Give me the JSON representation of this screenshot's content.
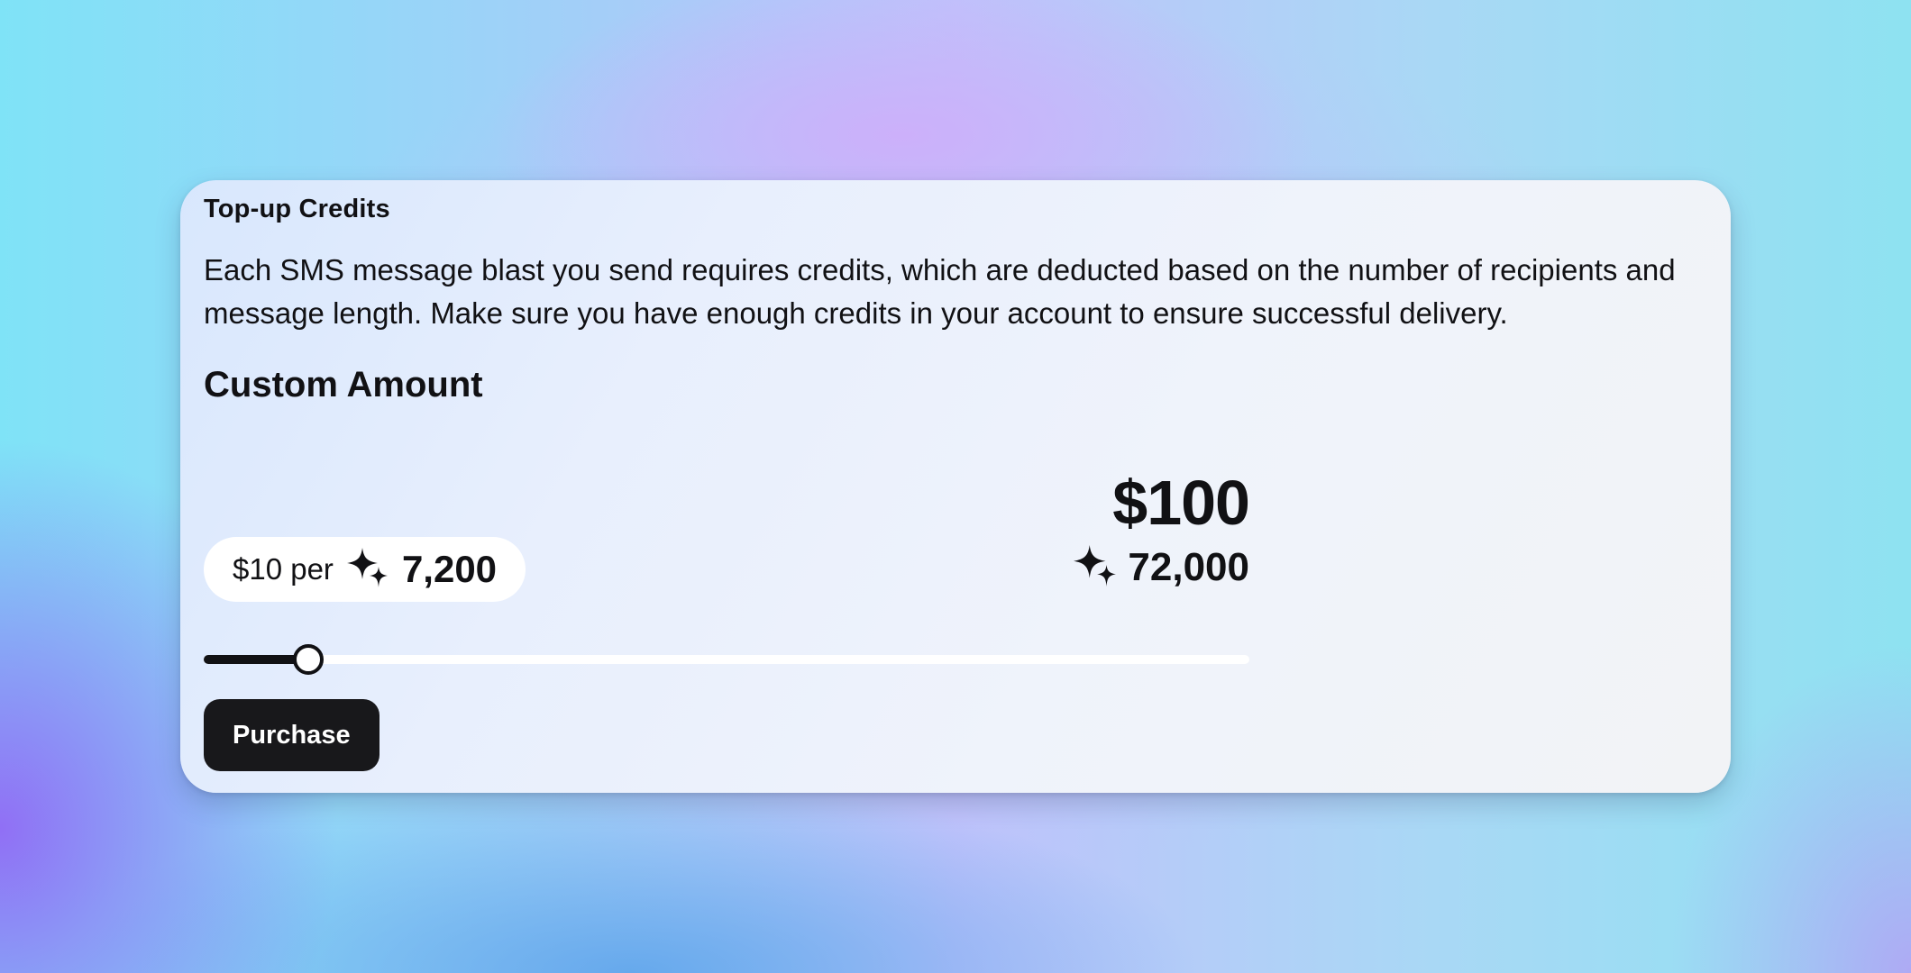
{
  "card": {
    "title": "Top-up Credits",
    "description": "Each SMS message blast you send requires credits, which are deducted based on the number of recipients and message length. Make sure you have enough credits in your account to ensure successful delivery.",
    "section_title": "Custom Amount"
  },
  "rate": {
    "prefix": "$10 per",
    "icon": "sparkles-icon",
    "credits": "7,200"
  },
  "total": {
    "amount": "$100",
    "icon": "sparkles-icon",
    "credits": "72,000"
  },
  "slider": {
    "level": 0.1
  },
  "actions": {
    "purchase_label": "Purchase"
  },
  "colors": {
    "primary": "#18181b",
    "track": "#ffffff",
    "card_background": "#eef2fb"
  }
}
